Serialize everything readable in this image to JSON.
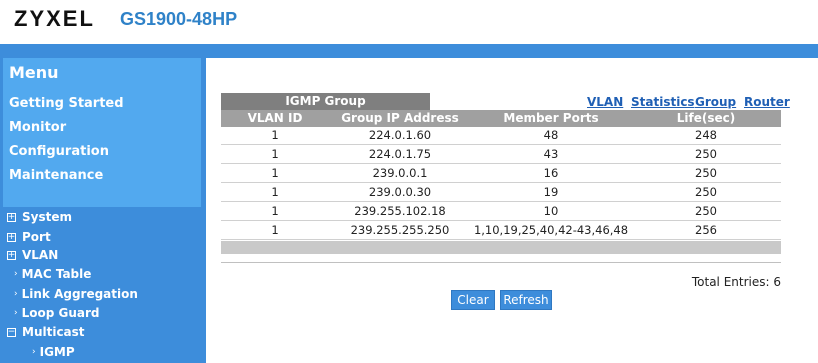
{
  "brand": {
    "logo": "ZYXEL",
    "model": "GS1900-48HP"
  },
  "menu": {
    "title": "Menu",
    "items": [
      "Getting Started",
      "Monitor",
      "Configuration",
      "Maintenance"
    ]
  },
  "tree": [
    {
      "label": "System",
      "kind": "expand"
    },
    {
      "label": "Port",
      "kind": "expand"
    },
    {
      "label": "VLAN",
      "kind": "expand"
    },
    {
      "label": "MAC Table",
      "kind": "leaf"
    },
    {
      "label": "Link Aggregation",
      "kind": "leaf"
    },
    {
      "label": "Loop Guard",
      "kind": "leaf"
    },
    {
      "label": "Multicast",
      "kind": "collapse"
    },
    {
      "label": "IGMP",
      "kind": "leaf-sub"
    }
  ],
  "tab": {
    "label": "IGMP Group"
  },
  "links": [
    "VLAN",
    "Statistics",
    "Group",
    "Router"
  ],
  "table": {
    "headers": [
      "VLAN ID",
      "Group IP Address",
      "Member Ports",
      "Life(sec)"
    ],
    "rows": [
      [
        "1",
        "224.0.1.60",
        "48",
        "248"
      ],
      [
        "1",
        "224.0.1.75",
        "43",
        "250"
      ],
      [
        "1",
        "239.0.0.1",
        "16",
        "250"
      ],
      [
        "1",
        "239.0.0.30",
        "19",
        "250"
      ],
      [
        "1",
        "239.255.102.18",
        "10",
        "250"
      ],
      [
        "1",
        "239.255.255.250",
        "1,10,19,25,40,42-43,46,48",
        "256"
      ]
    ]
  },
  "total": "Total Entries: 6",
  "buttons": {
    "clear": "Clear",
    "refresh": "Refresh"
  }
}
